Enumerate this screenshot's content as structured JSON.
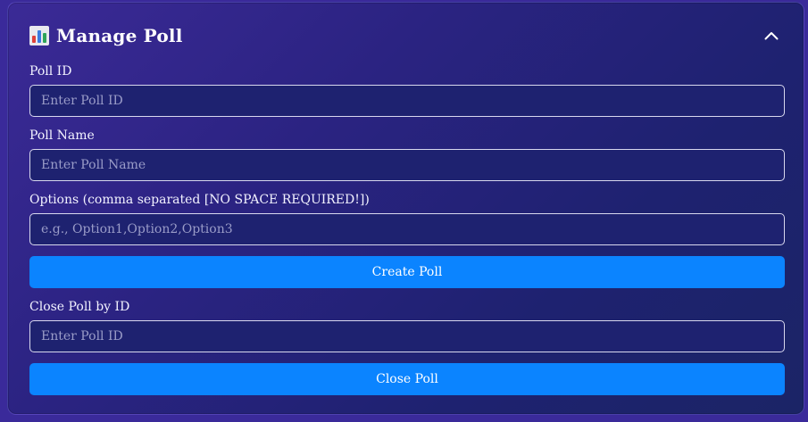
{
  "panel": {
    "title": "Manage Poll",
    "title_icon": "bar-chart-icon",
    "collapse_icon": "chevron-up-icon"
  },
  "poll_id": {
    "label": "Poll ID",
    "placeholder": "Enter Poll ID",
    "value": ""
  },
  "poll_name": {
    "label": "Poll Name",
    "placeholder": "Enter Poll Name",
    "value": ""
  },
  "options": {
    "label": "Options (comma separated [NO SPACE REQUIRED!])",
    "placeholder": "e.g., Option1,Option2,Option3",
    "value": ""
  },
  "create_button": {
    "label": "Create Poll"
  },
  "close_poll_id": {
    "label": "Close Poll by ID",
    "placeholder": "Enter Poll ID",
    "value": ""
  },
  "close_button": {
    "label": "Close Poll"
  },
  "colors": {
    "accent_button": "#0b84ff",
    "panel_gradient_start": "#3b2a96",
    "panel_gradient_end": "#1b2466",
    "text": "#ffffff",
    "placeholder": "#9a9cc8"
  }
}
